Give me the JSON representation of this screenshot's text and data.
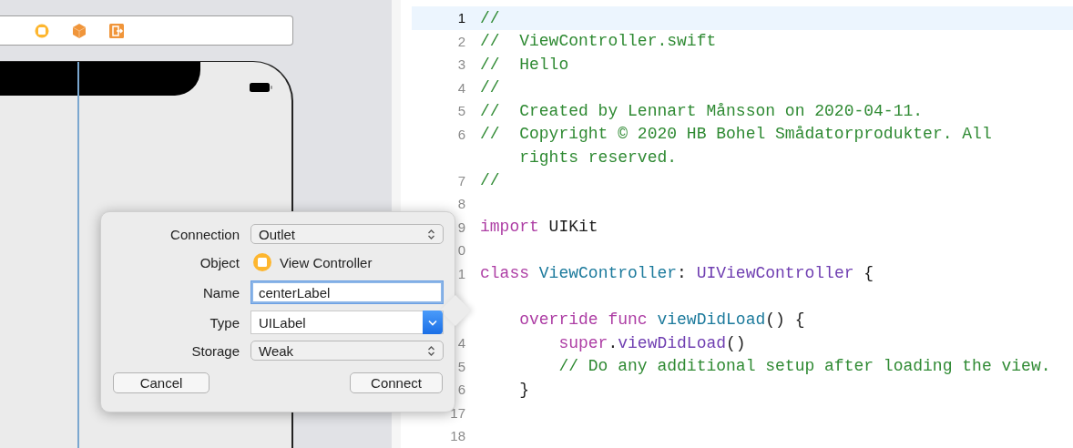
{
  "editor": {
    "lines": [
      {
        "number": "1",
        "current": true,
        "kind": "code",
        "tokens": [
          {
            "kind": "comment",
            "text": "//"
          }
        ]
      },
      {
        "number": "2",
        "current": false,
        "kind": "code",
        "tokens": [
          {
            "kind": "comment",
            "text": "//  ViewController.swift"
          }
        ]
      },
      {
        "number": "3",
        "current": false,
        "kind": "code",
        "tokens": [
          {
            "kind": "comment",
            "text": "//  Hello"
          }
        ]
      },
      {
        "number": "4",
        "current": false,
        "kind": "code",
        "tokens": [
          {
            "kind": "comment",
            "text": "//"
          }
        ]
      },
      {
        "number": "5",
        "current": false,
        "kind": "code",
        "tokens": [
          {
            "kind": "comment",
            "text": "//  Created by Lennart Månsson on 2020-04-11."
          }
        ]
      },
      {
        "number": "6",
        "current": false,
        "kind": "code",
        "tokens": [
          {
            "kind": "comment",
            "text": "//  Copyright © 2020 HB Bohel Smådatorprodukter. All"
          }
        ]
      },
      {
        "current": false,
        "kind": "continuation",
        "tokens": [
          {
            "kind": "comment",
            "text": "rights reserved."
          }
        ]
      },
      {
        "number": "7",
        "current": false,
        "kind": "code",
        "tokens": [
          {
            "kind": "comment",
            "text": "//"
          }
        ]
      },
      {
        "number": "8",
        "current": false,
        "kind": "blank"
      },
      {
        "number": "9",
        "current": false,
        "kind": "code",
        "tokens": [
          {
            "kind": "keyword",
            "text": "import"
          },
          {
            "kind": "plain",
            "text": " UIKit"
          }
        ]
      },
      {
        "number": "0",
        "current": false,
        "kind": "blank"
      },
      {
        "number": "1",
        "current": false,
        "kind": "code",
        "tokens": [
          {
            "kind": "keyword",
            "text": "class"
          },
          {
            "kind": "declaration",
            "text": " ViewController"
          },
          {
            "kind": "plain",
            "text": ": "
          },
          {
            "kind": "type",
            "text": "UIViewController"
          },
          {
            "kind": "plain",
            "text": " {"
          }
        ]
      },
      {
        "current": false,
        "kind": "blank"
      },
      {
        "current": false,
        "kind": "nested",
        "tokens": [
          {
            "kind": "keyword",
            "text": "override func"
          },
          {
            "kind": "declaration",
            "text": " viewDidLoad"
          },
          {
            "kind": "plain",
            "text": "() {"
          }
        ]
      },
      {
        "number": "4",
        "current": false,
        "kind": "nested2",
        "tokens": [
          {
            "kind": "keyword",
            "text": "super"
          },
          {
            "kind": "plain",
            "text": "."
          },
          {
            "kind": "type",
            "text": "viewDidLoad"
          },
          {
            "kind": "plain",
            "text": "()"
          }
        ]
      },
      {
        "number": "5",
        "current": false,
        "kind": "nested2",
        "tokens": [
          {
            "kind": "comment",
            "text": "// Do any additional setup after loading the view."
          }
        ]
      },
      {
        "number": "6",
        "current": false,
        "kind": "nested",
        "tokens": [
          {
            "kind": "plain",
            "text": "}"
          }
        ]
      },
      {
        "number": "17",
        "current": false,
        "kind": "blank"
      },
      {
        "number": "18",
        "current": false,
        "kind": "blank"
      }
    ]
  },
  "popover": {
    "fields": [
      {
        "label": "Connection",
        "kind": "popup",
        "value": "Outlet",
        "focused": false
      },
      {
        "label": "Object",
        "kind": "object",
        "value": "View Controller"
      },
      {
        "label": "Name",
        "kind": "text",
        "value": "centerLabel",
        "focused": true
      },
      {
        "label": "Type",
        "kind": "combo",
        "value": "UILabel",
        "focused": false
      },
      {
        "label": "Storage",
        "kind": "popup",
        "value": "Weak",
        "focused": false
      }
    ],
    "buttons": [
      "Cancel",
      "Connect"
    ]
  }
}
